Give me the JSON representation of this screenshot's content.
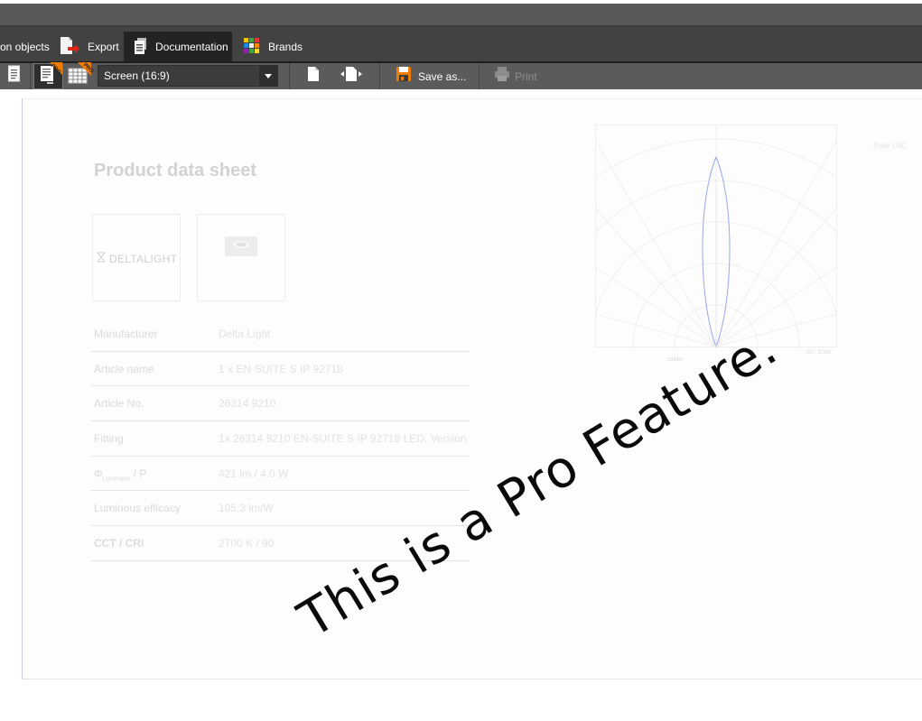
{
  "tabs": [
    {
      "label": "on objects",
      "icon": "objects-icon"
    },
    {
      "label": "Export",
      "icon": "export-icon"
    },
    {
      "label": "Documentation",
      "icon": "documentation-icon",
      "active": true
    },
    {
      "label": "Brands",
      "icon": "brands-icon"
    }
  ],
  "toolbar": {
    "view_select": {
      "value": "Screen (16:9)"
    },
    "pro_badge": "PRO",
    "save_label": "Save as...",
    "print_label": "Print"
  },
  "document": {
    "title": "Product data sheet",
    "brand_logo_text": "DELTALIGHT",
    "specs": [
      {
        "key": "Manufacturer",
        "value": "Delta Light"
      },
      {
        "key": "Article name",
        "value": "1 x EN-SUITE S IP 92718"
      },
      {
        "key": "Article No.",
        "value": "26314 9210"
      },
      {
        "key": "Fitting",
        "value": "1x 26314 9210 EN-SUITE S IP 92718 LED, Version"
      },
      {
        "key_main": "Φ",
        "key_sub": "Luminaire",
        "key_rest": " / P",
        "value": "421 lm / 4.0 W"
      },
      {
        "key": "Luminous efficacy",
        "value": "105.3 lm/W"
      },
      {
        "key": "CCT / CRI",
        "value": "2700 K / 90"
      }
    ],
    "polar": {
      "legend": "Polar LDC",
      "cd_label": "cd/klm",
      "angle_label": "C0 - C180"
    }
  },
  "watermark": "This is a Pro Feature.",
  "colors": {
    "tab_bar": "#424242",
    "tab_active": "#232323",
    "toolbar": "#5b5b5b",
    "accent_orange": "#f07d00",
    "polar_curve": "#9da6ee"
  }
}
